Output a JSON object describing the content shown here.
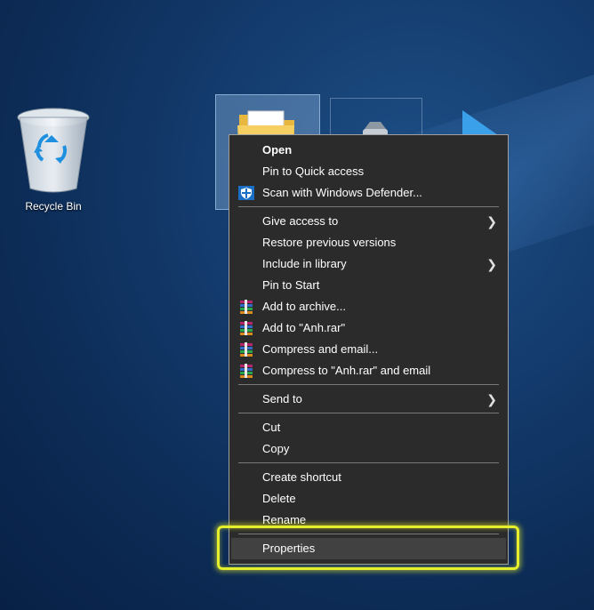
{
  "desktop": {
    "recycle_bin_label": "Recycle Bin"
  },
  "context_menu": {
    "open": "Open",
    "pin_quick_access": "Pin to Quick access",
    "scan_defender": "Scan with Windows Defender...",
    "give_access": "Give access to",
    "restore_versions": "Restore previous versions",
    "include_library": "Include in library",
    "pin_start": "Pin to Start",
    "add_archive": "Add to archive...",
    "add_rar": "Add to \"Anh.rar\"",
    "compress_email": "Compress and email...",
    "compress_rar_email": "Compress to \"Anh.rar\" and email",
    "send_to": "Send to",
    "cut": "Cut",
    "copy": "Copy",
    "create_shortcut": "Create shortcut",
    "delete": "Delete",
    "rename": "Rename",
    "properties": "Properties"
  },
  "icons": {
    "recycle_bin": "recycle-bin-icon",
    "folder": "folder-icon",
    "defender": "shield-icon",
    "winrar": "winrar-icon",
    "submenu": "chevron-right-icon"
  },
  "colors": {
    "menu_bg": "#2b2b2b",
    "menu_hover": "#414141",
    "highlight": "#e5ef2b",
    "desktop_blue": "#143c6e"
  }
}
